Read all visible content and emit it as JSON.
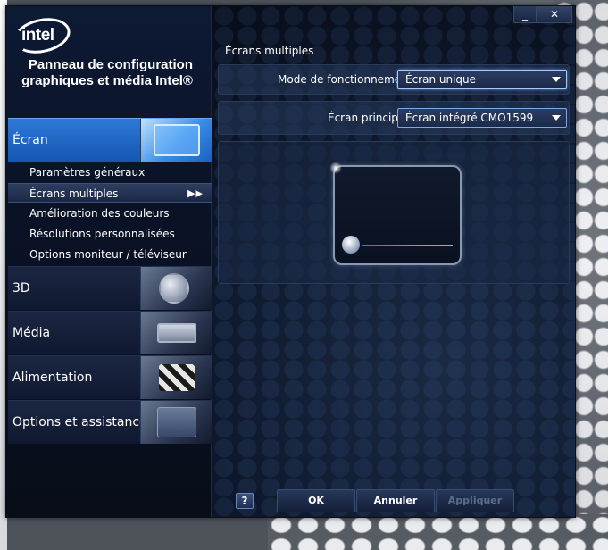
{
  "window": {
    "logo": "intel",
    "app_title": "Panneau de configuration graphiques et média Intel®",
    "minimize_glyph": "_",
    "close_glyph": "✕"
  },
  "sidebar": {
    "categories": [
      {
        "label": "Écran",
        "icon": "display-monitors-icon",
        "active": true
      },
      {
        "label": "3D",
        "icon": "3d-shapes-icon",
        "active": false
      },
      {
        "label": "Média",
        "icon": "media-camera-icon",
        "active": false
      },
      {
        "label": "Alimentation",
        "icon": "power-flags-icon",
        "active": false
      },
      {
        "label": "Options et assistance",
        "icon": "tools-help-icon",
        "active": false
      }
    ],
    "sub_items": [
      {
        "label": "Paramètres généraux",
        "selected": false
      },
      {
        "label": "Écrans multiples",
        "selected": true,
        "arrow": "▶▶"
      },
      {
        "label": "Amélioration des couleurs",
        "selected": false
      },
      {
        "label": "Résolutions personnalisées",
        "selected": false
      },
      {
        "label": "Options moniteur / téléviseur",
        "selected": false
      }
    ]
  },
  "main": {
    "section_title": "Écrans multiples",
    "mode": {
      "label": "Mode de fonctionnement",
      "value": "Écran unique"
    },
    "primary": {
      "label": "Écran principal",
      "value": "Écran intégré CMO1599"
    }
  },
  "footer": {
    "help": "?",
    "ok": "OK",
    "cancel": "Annuler",
    "apply": "Appliquer"
  },
  "colors": {
    "accent": "#1c63c4",
    "panel_bg": "#0b1120",
    "text": "#ffffff"
  }
}
